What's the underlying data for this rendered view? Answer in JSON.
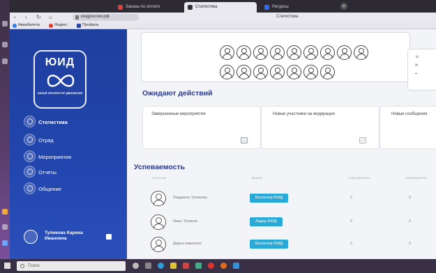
{
  "browser": {
    "tabs": [
      {
        "label": "Заказы по оплате"
      },
      {
        "label": "Статистика"
      },
      {
        "label": "Ресурсы"
      }
    ],
    "url": "юидроссии.рф",
    "page_title": "Статистика",
    "bookmarks": [
      "Авиабилеты",
      "Яндекс",
      "Профиль"
    ]
  },
  "sidebar": {
    "logo_title": "ЮИД",
    "logo_sub": "ЮНЫЙ ИНСПЕКТОР ДВИЖЕНИЯ",
    "items": [
      {
        "label": "Статистика"
      },
      {
        "label": "Отряд"
      },
      {
        "label": "Мероприятия"
      },
      {
        "label": "Отчеты"
      },
      {
        "label": "Общение"
      }
    ],
    "user_name": "Тупикова Карина Ивановна"
  },
  "main": {
    "awaiting_title": "Ожидают действий",
    "cards": [
      {
        "label": "Завершенные мероприятия"
      },
      {
        "label": "Новые участники на модерации"
      },
      {
        "label": "Новые сообщения"
      }
    ],
    "progress_title": "Успеваемость",
    "table_headers": [
      "Участник",
      "Звание",
      "Сертификаты",
      "Мероприятия"
    ],
    "rows": [
      {
        "name": "Людмила Тупикова",
        "badge": "Волонтер ЮИД",
        "v1": "0",
        "v2": "0"
      },
      {
        "name": "Иван Тупиков",
        "badge": "Лидер ЮИД",
        "v1": "0",
        "v2": "0"
      },
      {
        "name": "Дарья павленко",
        "badge": "Волонтер ЮИД",
        "v1": "0",
        "v2": "0"
      }
    ]
  },
  "taskbar": {
    "search_placeholder": "Поиск"
  },
  "colors": {
    "sidebar": "#2145ad",
    "badge": "#29a9d6",
    "heading": "#2b3a8c"
  }
}
